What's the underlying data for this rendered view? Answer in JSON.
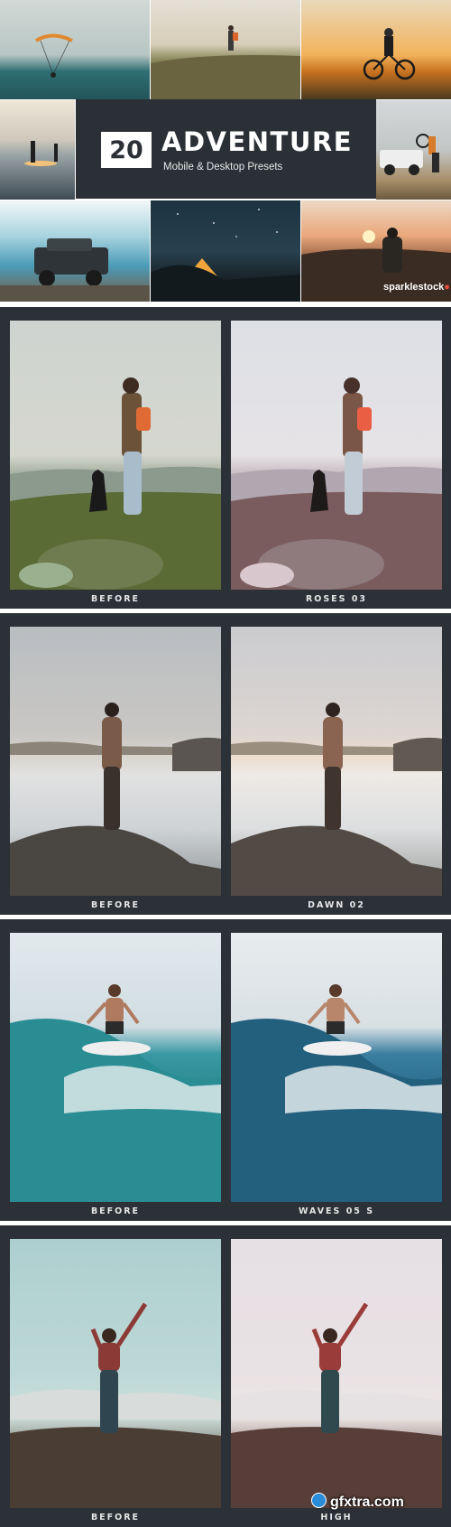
{
  "header": {
    "count": "20",
    "title": "ADVENTURE",
    "subtitle": "Mobile & Desktop Presets"
  },
  "brand": {
    "name": "sparklestock"
  },
  "comparisons": [
    {
      "before_label": "BEFORE",
      "after_label": "ROSES 03"
    },
    {
      "before_label": "BEFORE",
      "after_label": "DAWN 02"
    },
    {
      "before_label": "BEFORE",
      "after_label": "WAVES 05 S"
    },
    {
      "before_label": "BEFORE",
      "after_label": "HIGH"
    }
  ],
  "watermark": {
    "text": "gfxtra.com"
  },
  "colors": {
    "panel": "#2c3137",
    "header_panel": "#2b3036",
    "text": "#ffffff"
  }
}
